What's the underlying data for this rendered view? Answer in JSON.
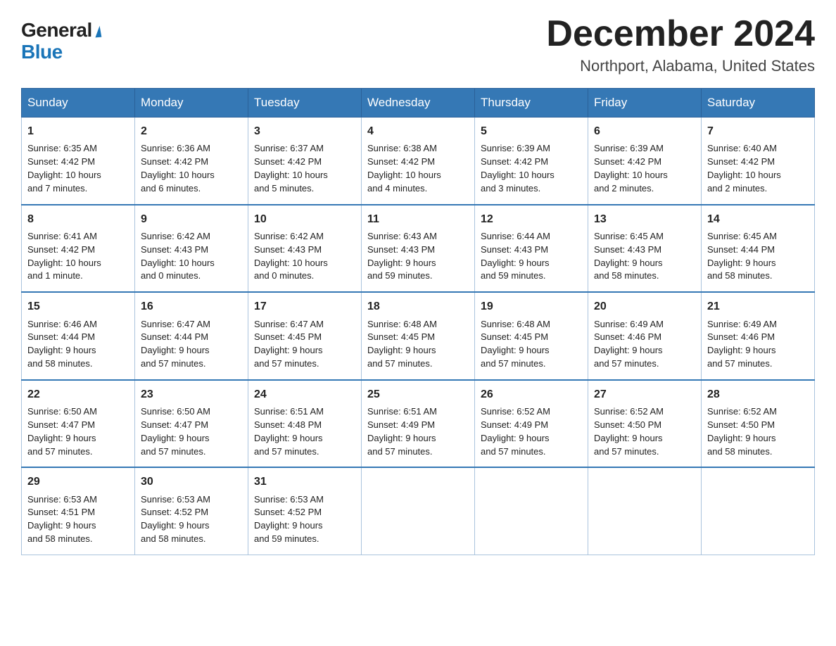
{
  "logo": {
    "general": "General",
    "blue": "Blue"
  },
  "header": {
    "month": "December 2024",
    "location": "Northport, Alabama, United States"
  },
  "weekdays": [
    "Sunday",
    "Monday",
    "Tuesday",
    "Wednesday",
    "Thursday",
    "Friday",
    "Saturday"
  ],
  "weeks": [
    [
      {
        "day": "1",
        "info": "Sunrise: 6:35 AM\nSunset: 4:42 PM\nDaylight: 10 hours\nand 7 minutes."
      },
      {
        "day": "2",
        "info": "Sunrise: 6:36 AM\nSunset: 4:42 PM\nDaylight: 10 hours\nand 6 minutes."
      },
      {
        "day": "3",
        "info": "Sunrise: 6:37 AM\nSunset: 4:42 PM\nDaylight: 10 hours\nand 5 minutes."
      },
      {
        "day": "4",
        "info": "Sunrise: 6:38 AM\nSunset: 4:42 PM\nDaylight: 10 hours\nand 4 minutes."
      },
      {
        "day": "5",
        "info": "Sunrise: 6:39 AM\nSunset: 4:42 PM\nDaylight: 10 hours\nand 3 minutes."
      },
      {
        "day": "6",
        "info": "Sunrise: 6:39 AM\nSunset: 4:42 PM\nDaylight: 10 hours\nand 2 minutes."
      },
      {
        "day": "7",
        "info": "Sunrise: 6:40 AM\nSunset: 4:42 PM\nDaylight: 10 hours\nand 2 minutes."
      }
    ],
    [
      {
        "day": "8",
        "info": "Sunrise: 6:41 AM\nSunset: 4:42 PM\nDaylight: 10 hours\nand 1 minute."
      },
      {
        "day": "9",
        "info": "Sunrise: 6:42 AM\nSunset: 4:43 PM\nDaylight: 10 hours\nand 0 minutes."
      },
      {
        "day": "10",
        "info": "Sunrise: 6:42 AM\nSunset: 4:43 PM\nDaylight: 10 hours\nand 0 minutes."
      },
      {
        "day": "11",
        "info": "Sunrise: 6:43 AM\nSunset: 4:43 PM\nDaylight: 9 hours\nand 59 minutes."
      },
      {
        "day": "12",
        "info": "Sunrise: 6:44 AM\nSunset: 4:43 PM\nDaylight: 9 hours\nand 59 minutes."
      },
      {
        "day": "13",
        "info": "Sunrise: 6:45 AM\nSunset: 4:43 PM\nDaylight: 9 hours\nand 58 minutes."
      },
      {
        "day": "14",
        "info": "Sunrise: 6:45 AM\nSunset: 4:44 PM\nDaylight: 9 hours\nand 58 minutes."
      }
    ],
    [
      {
        "day": "15",
        "info": "Sunrise: 6:46 AM\nSunset: 4:44 PM\nDaylight: 9 hours\nand 58 minutes."
      },
      {
        "day": "16",
        "info": "Sunrise: 6:47 AM\nSunset: 4:44 PM\nDaylight: 9 hours\nand 57 minutes."
      },
      {
        "day": "17",
        "info": "Sunrise: 6:47 AM\nSunset: 4:45 PM\nDaylight: 9 hours\nand 57 minutes."
      },
      {
        "day": "18",
        "info": "Sunrise: 6:48 AM\nSunset: 4:45 PM\nDaylight: 9 hours\nand 57 minutes."
      },
      {
        "day": "19",
        "info": "Sunrise: 6:48 AM\nSunset: 4:45 PM\nDaylight: 9 hours\nand 57 minutes."
      },
      {
        "day": "20",
        "info": "Sunrise: 6:49 AM\nSunset: 4:46 PM\nDaylight: 9 hours\nand 57 minutes."
      },
      {
        "day": "21",
        "info": "Sunrise: 6:49 AM\nSunset: 4:46 PM\nDaylight: 9 hours\nand 57 minutes."
      }
    ],
    [
      {
        "day": "22",
        "info": "Sunrise: 6:50 AM\nSunset: 4:47 PM\nDaylight: 9 hours\nand 57 minutes."
      },
      {
        "day": "23",
        "info": "Sunrise: 6:50 AM\nSunset: 4:47 PM\nDaylight: 9 hours\nand 57 minutes."
      },
      {
        "day": "24",
        "info": "Sunrise: 6:51 AM\nSunset: 4:48 PM\nDaylight: 9 hours\nand 57 minutes."
      },
      {
        "day": "25",
        "info": "Sunrise: 6:51 AM\nSunset: 4:49 PM\nDaylight: 9 hours\nand 57 minutes."
      },
      {
        "day": "26",
        "info": "Sunrise: 6:52 AM\nSunset: 4:49 PM\nDaylight: 9 hours\nand 57 minutes."
      },
      {
        "day": "27",
        "info": "Sunrise: 6:52 AM\nSunset: 4:50 PM\nDaylight: 9 hours\nand 57 minutes."
      },
      {
        "day": "28",
        "info": "Sunrise: 6:52 AM\nSunset: 4:50 PM\nDaylight: 9 hours\nand 58 minutes."
      }
    ],
    [
      {
        "day": "29",
        "info": "Sunrise: 6:53 AM\nSunset: 4:51 PM\nDaylight: 9 hours\nand 58 minutes."
      },
      {
        "day": "30",
        "info": "Sunrise: 6:53 AM\nSunset: 4:52 PM\nDaylight: 9 hours\nand 58 minutes."
      },
      {
        "day": "31",
        "info": "Sunrise: 6:53 AM\nSunset: 4:52 PM\nDaylight: 9 hours\nand 59 minutes."
      },
      null,
      null,
      null,
      null
    ]
  ],
  "colors": {
    "header_bg": "#3578b5",
    "header_text": "#ffffff",
    "border": "#3578b5",
    "cell_border": "#aac4dd"
  }
}
